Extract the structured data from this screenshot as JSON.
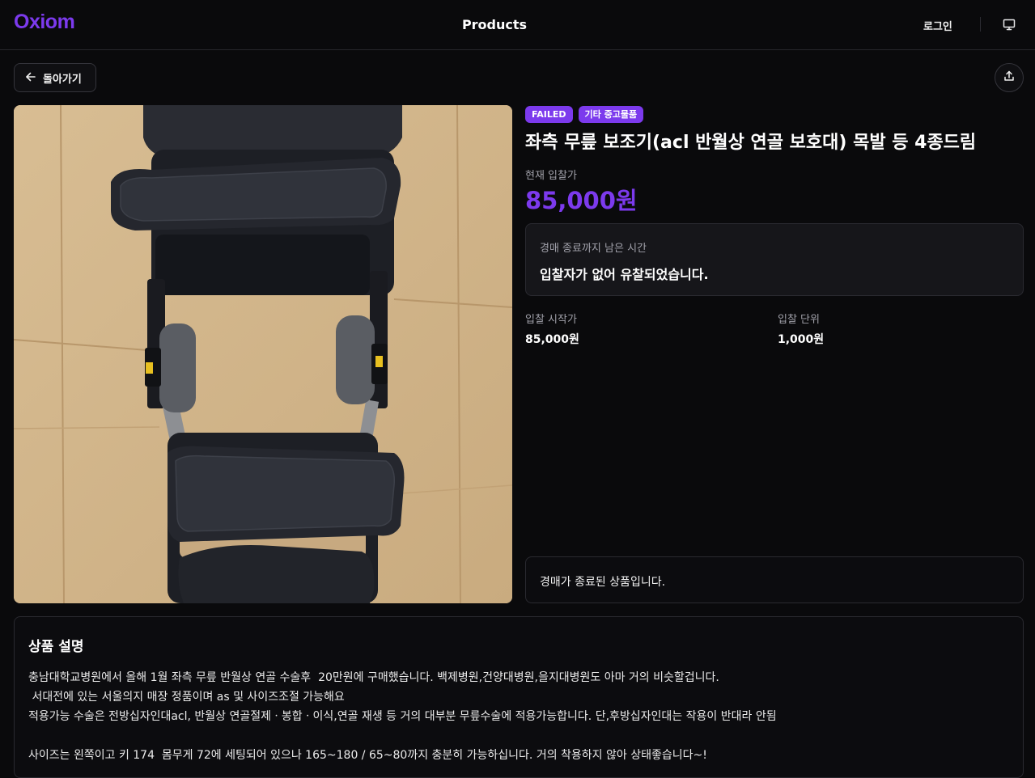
{
  "header": {
    "logo": "Oxiom",
    "nav_title": "Products",
    "login_label": "로그인",
    "monitor_icon": "monitor-icon",
    "brand_color": "#7c3aed"
  },
  "toolbar": {
    "back_label": "돌아가기",
    "back_icon": "arrow-left-icon",
    "share_icon": "share-icon"
  },
  "product": {
    "image_alt": "knee-brace-photo",
    "badges": [
      "FAILED",
      "기타 중고물품"
    ],
    "title": "좌측 무릎 보조기(acl 반월상 연골 보호대) 목발 등 4종드림",
    "current_bid_label": "현재 입찰가",
    "current_bid": "85,000원",
    "timer_label": "경매 종료까지 남은 시간",
    "timer_message": "입찰자가 없어 유찰되었습니다.",
    "start_price_label": "입찰 시작가",
    "start_price": "85,000원",
    "bid_unit_label": "입찰 단위",
    "bid_unit": "1,000원",
    "ended_message": "경매가 종료된 상품입니다."
  },
  "description": {
    "heading": "상품 설명",
    "lines": [
      "충남대학교병원에서 올해 1월 좌측 무릎 반월상 연골 수술후  20만원에 구매했습니다. 백제병원,건양대병원,을지대병원도 아마 거의 비슷할겁니다.",
      " 서대전에 있는 서울의지 매장 정품이며 as 및 사이즈조절 가능해요",
      "적용가능 수술은 전방십자인대acl, 반월상 연골절제ㆍ봉합ㆍ이식,연골 재생 등 거의 대부분 무릎수술에 적용가능합니다. 단,후방십자인대는 작용이 반대라 안됨",
      "",
      "사이즈는 왼쪽이고 키 174  몸무게 72에 세팅되어 있으나 165~180 / 65~80까지 충분히 가능하십니다. 거의 착용하지 않아 상태좋습니다~!"
    ]
  }
}
